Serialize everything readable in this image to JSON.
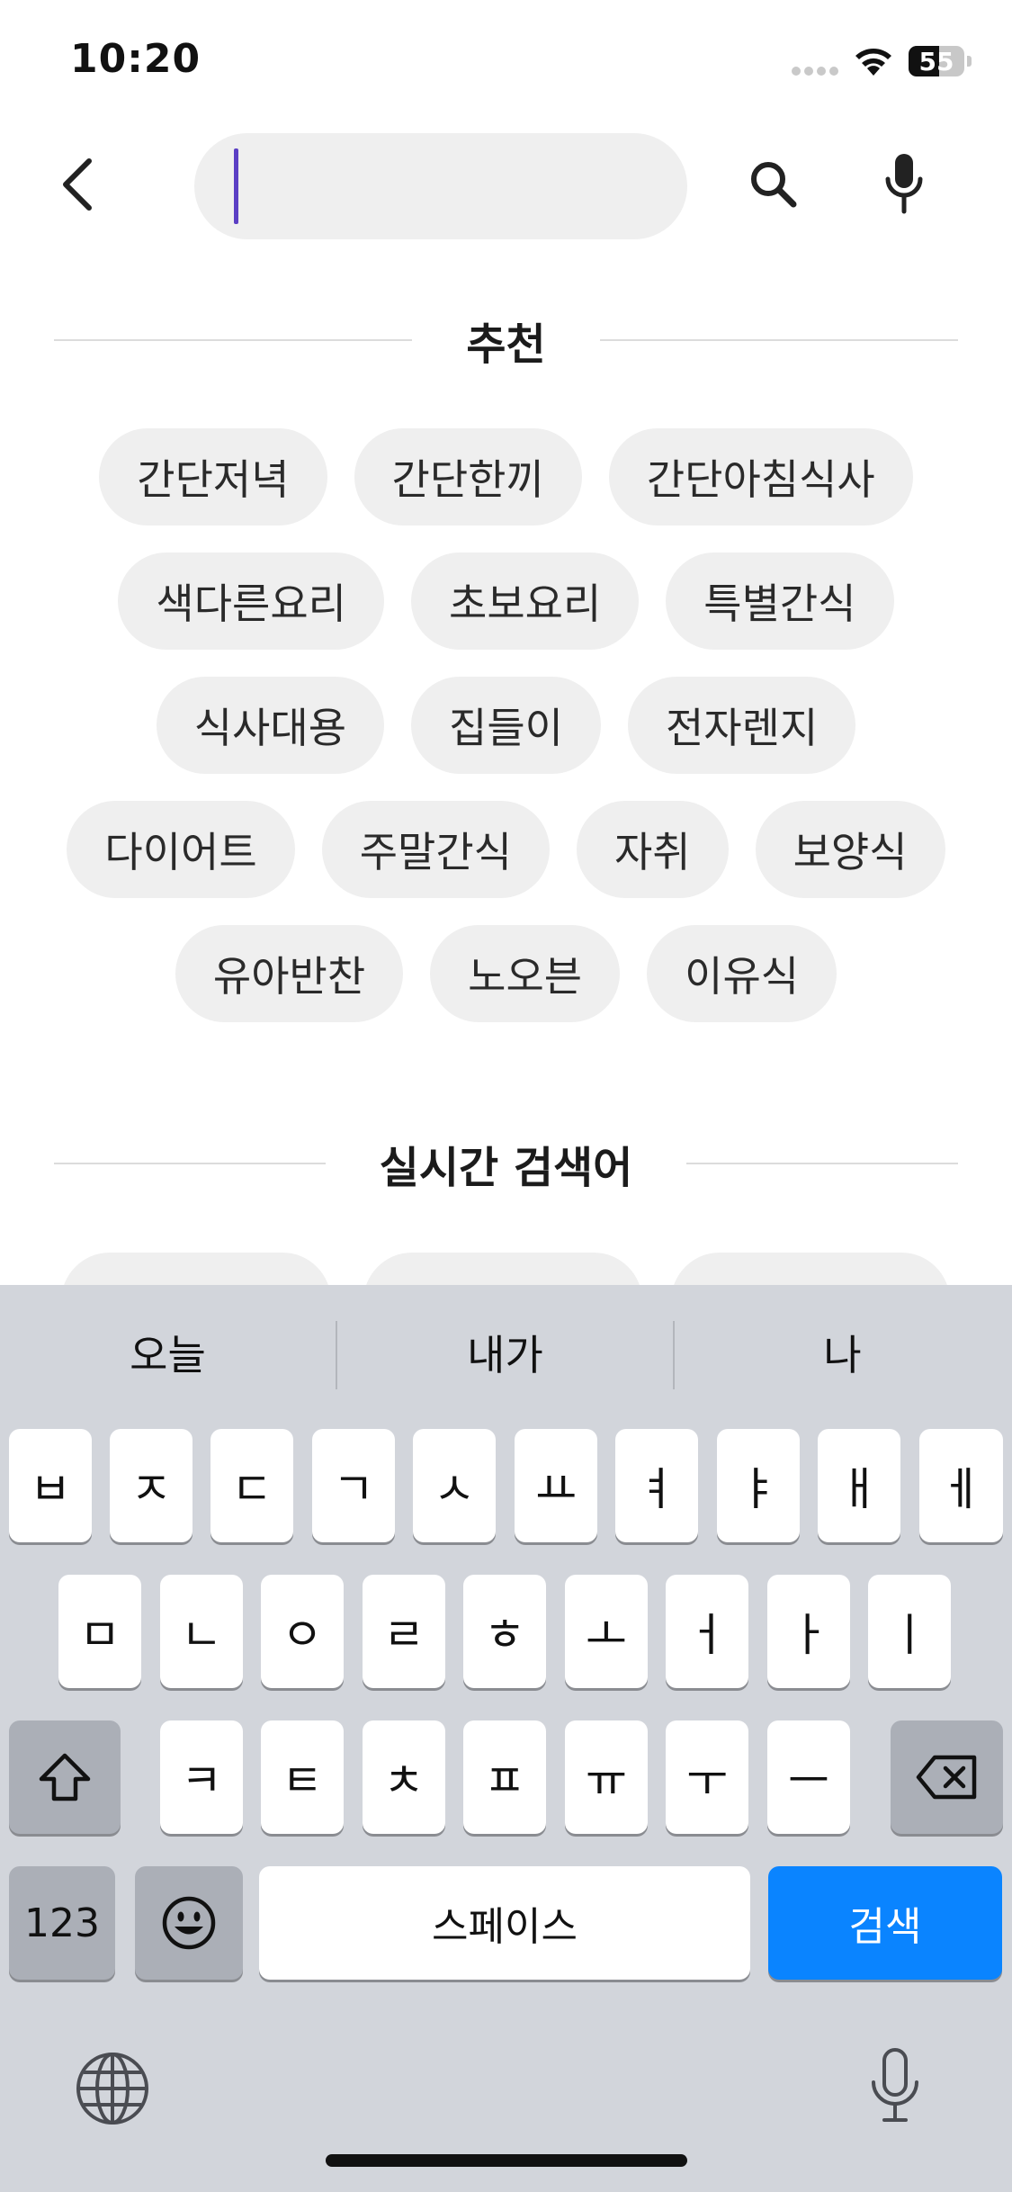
{
  "status_bar": {
    "time": "10:20",
    "battery": "55",
    "icons": [
      "cellular-signal-icon",
      "wifi-icon",
      "battery-icon"
    ]
  },
  "search": {
    "value": "",
    "placeholder": "",
    "icons": [
      "back-chevron-icon",
      "search-icon",
      "microphone-icon"
    ],
    "cursor_color": "#5b3fc4"
  },
  "recommended": {
    "title": "추천",
    "rows": [
      [
        "간단저녁",
        "간단한끼",
        "간단아침식사"
      ],
      [
        "색다른요리",
        "초보요리",
        "특별간식"
      ],
      [
        "식사대용",
        "집들이",
        "전자렌지"
      ],
      [
        "다이어트",
        "주말간식",
        "자취",
        "보양식"
      ],
      [
        "유아반찬",
        "노오븐",
        "이유식"
      ]
    ]
  },
  "realtime": {
    "title": "실시간 검색어"
  },
  "keyboard": {
    "suggestions": [
      "오늘",
      "내가",
      "나"
    ],
    "row1": [
      "ㅂ",
      "ㅈ",
      "ㄷ",
      "ㄱ",
      "ㅅ",
      "ㅛ",
      "ㅕ",
      "ㅑ",
      "ㅐ",
      "ㅔ"
    ],
    "row2": [
      "ㅁ",
      "ㄴ",
      "ㅇ",
      "ㄹ",
      "ㅎ",
      "ㅗ",
      "ㅓ",
      "ㅏ",
      "ㅣ"
    ],
    "row3": [
      "ㅋ",
      "ㅌ",
      "ㅊ",
      "ㅍ",
      "ㅠ",
      "ㅜ",
      "ㅡ"
    ],
    "numbers_label": "123",
    "space_label": "스페이스",
    "search_label": "검색",
    "accent_color": "#0a84ff",
    "icons": [
      "shift-icon",
      "delete-icon",
      "emoji-icon",
      "globe-icon",
      "dictation-icon"
    ]
  }
}
